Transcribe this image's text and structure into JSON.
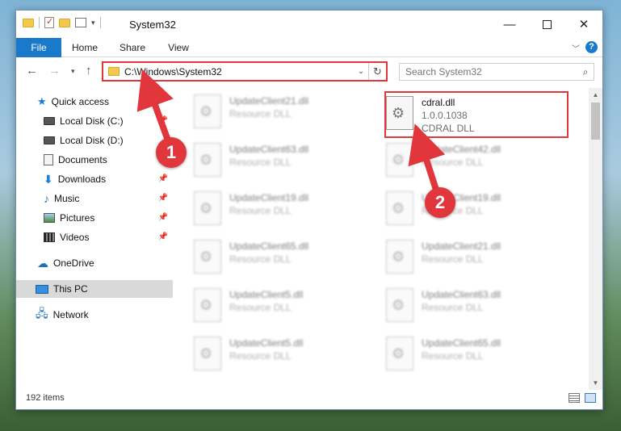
{
  "window": {
    "title": "System32",
    "controls": {
      "minimize": "—",
      "maximize": "",
      "close": "✕"
    }
  },
  "ribbon": {
    "tabs": [
      {
        "label": "File"
      },
      {
        "label": "Home"
      },
      {
        "label": "Share"
      },
      {
        "label": "View"
      }
    ],
    "help": "?"
  },
  "navigation": {
    "address_path": "C:\\Windows\\System32",
    "search_placeholder": "Search System32"
  },
  "sidebar": {
    "items": [
      {
        "label": "Quick access",
        "icon": "star-icon",
        "pinned": false
      },
      {
        "label": "Local Disk (C:)",
        "icon": "disk-icon",
        "pinned": true
      },
      {
        "label": "Local Disk (D:)",
        "icon": "disk-icon",
        "pinned": false
      },
      {
        "label": "Documents",
        "icon": "document-icon",
        "pinned": true
      },
      {
        "label": "Downloads",
        "icon": "download-icon",
        "pinned": true
      },
      {
        "label": "Music",
        "icon": "music-icon",
        "pinned": true
      },
      {
        "label": "Pictures",
        "icon": "pictures-icon",
        "pinned": true
      },
      {
        "label": "Videos",
        "icon": "videos-icon",
        "pinned": true
      },
      {
        "label": "OneDrive",
        "icon": "cloud-icon",
        "pinned": false
      },
      {
        "label": "This PC",
        "icon": "computer-icon",
        "pinned": false,
        "selected": true
      },
      {
        "label": "Network",
        "icon": "network-icon",
        "pinned": false
      }
    ]
  },
  "files": {
    "left_column": [
      {
        "name": "UpdateClient21.dll",
        "sub1": "Resource DLL",
        "sub2": ""
      },
      {
        "name": "UpdateClient63.dll",
        "sub1": "Resource DLL",
        "sub2": ""
      },
      {
        "name": "UpdateClient19.dll",
        "sub1": "Resource DLL",
        "sub2": ""
      },
      {
        "name": "UpdateClient65.dll",
        "sub1": "Resource DLL",
        "sub2": ""
      },
      {
        "name": "UpdateClient5.dll",
        "sub1": "Resource DLL",
        "sub2": ""
      },
      {
        "name": "UpdateClient5.dll",
        "sub1": "Resource DLL",
        "sub2": ""
      }
    ],
    "right_column": [
      {
        "name": "cdral.dll",
        "sub1": "1.0.0.1038",
        "sub2": "CDRAL DLL",
        "focus": true
      },
      {
        "name": "UpdateClient42.dll",
        "sub1": "Resource DLL",
        "sub2": ""
      },
      {
        "name": "UpdateClient19.dll",
        "sub1": "Resource DLL",
        "sub2": ""
      },
      {
        "name": "UpdateClient21.dll",
        "sub1": "Resource DLL",
        "sub2": ""
      },
      {
        "name": "UpdateClient63.dll",
        "sub1": "Resource DLL",
        "sub2": ""
      },
      {
        "name": "UpdateClient65.dll",
        "sub1": "Resource DLL",
        "sub2": ""
      }
    ]
  },
  "status": {
    "item_count": "192 items"
  },
  "annotations": [
    {
      "number": "1"
    },
    {
      "number": "2"
    }
  ],
  "colors": {
    "accent": "#1979ca",
    "highlight": "#e0363c"
  }
}
